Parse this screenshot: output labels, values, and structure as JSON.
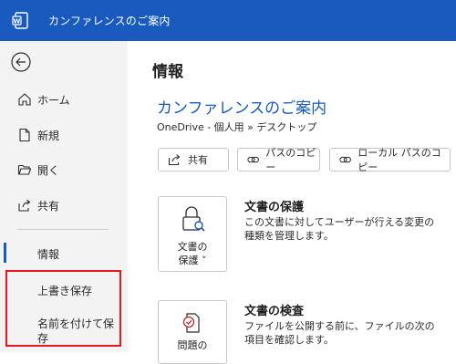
{
  "titlebar": {
    "title": "カンファレンスのご案内",
    "bg_color": "#185abd",
    "icon": "word-icon"
  },
  "sidebar": {
    "back_icon": "back-arrow-icon",
    "items": [
      {
        "id": "home",
        "label": "ホーム",
        "icon": "home-icon"
      },
      {
        "id": "new",
        "label": "新規",
        "icon": "new-document-icon"
      },
      {
        "id": "open",
        "label": "開く",
        "icon": "folder-icon"
      },
      {
        "id": "share",
        "label": "共有",
        "icon": "share-icon"
      }
    ],
    "info": "情報",
    "save": "上書き保存",
    "save_as": "名前を付けて保\n存",
    "highlight_color": "#e8171e"
  },
  "main": {
    "page_title": "情報",
    "doc_title": "カンファレンスのご案内",
    "doc_path": "OneDrive - 個人用 » デスクトップ",
    "buttons": {
      "share": "共有",
      "copy_path": "パスのコピー",
      "copy_local_path": "ローカル パスのコピー"
    },
    "protect": {
      "tile_label_line1": "文書の",
      "tile_label_line2": "保護 ˅",
      "heading": "文書の保護",
      "description": "この文書に対してユーザーが行える変更の種類を管理します。"
    },
    "inspect": {
      "tile_label_line1": "問題の",
      "heading": "文書の検査",
      "description": "ファイルを公開する前に、ファイルの次の項目を確認します。"
    }
  }
}
